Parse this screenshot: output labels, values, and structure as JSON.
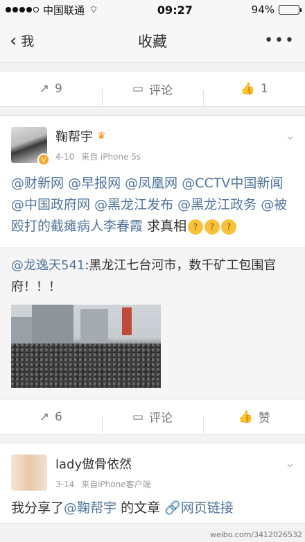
{
  "status_bar": {
    "carrier": "中国联通",
    "time": "09:27",
    "battery": "94%",
    "battery_level": 0.94
  },
  "nav": {
    "back_label": "我",
    "title": "收藏"
  },
  "post0": {
    "repost_count": "9",
    "comment_label": "评论",
    "like_count": "1"
  },
  "post1": {
    "author": "鞠帮宇",
    "date": "4-10",
    "source": "来自 iPhone 5s",
    "mentions": [
      "@财新网",
      "@早报网",
      "@凤凰网",
      "@CCTV中国新闻",
      "@中国政府网",
      "@黑龙江发布",
      "@黑龙江政务",
      "@被殴打的截瘫病人李春霞"
    ],
    "text_tail": "求真相",
    "repost_user": "@龙逸天541",
    "repost_text": ":黑龙江七台河市，数千矿工包围官府！！！",
    "repost_count": "6",
    "comment_label": "评论",
    "like_label": "赞"
  },
  "post2": {
    "author": "lady傲骨依然",
    "date": "3-14",
    "source": "来自iPhone客户端",
    "text_prefix": "我分享了",
    "mention": "@鞠帮宇",
    "text_mid": " 的文章 ",
    "link_text": "网页链接"
  },
  "watermark": "weibo.com/3412026532"
}
